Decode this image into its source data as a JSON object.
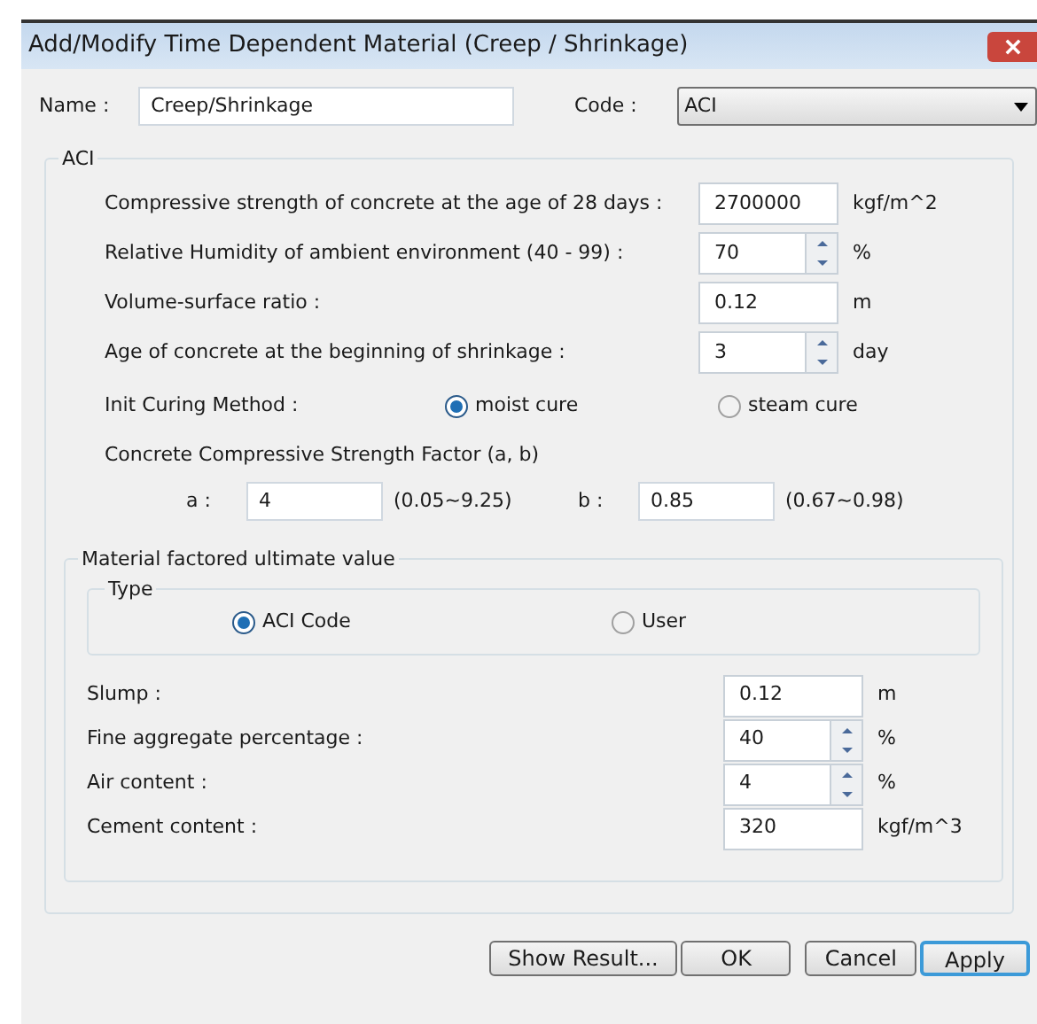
{
  "window": {
    "title": "Add/Modify Time Dependent Material (Creep / Shrinkage)"
  },
  "name": {
    "label": "Name :",
    "value": "Creep/Shrinkage"
  },
  "code": {
    "label": "Code :",
    "value": "ACI"
  },
  "aci_group": {
    "title": "ACI",
    "fields": [
      {
        "label": "Compressive strength of concrete at the age of 28 days :",
        "value": "2700000",
        "unit": "kgf/m^2",
        "kind": "text"
      },
      {
        "label": "Relative Humidity of ambient environment (40 - 99) :",
        "value": "70",
        "unit": "%",
        "kind": "spin"
      },
      {
        "label": "Volume-surface ratio :",
        "value": "0.12",
        "unit": "m",
        "kind": "text"
      },
      {
        "label": "Age of concrete at the beginning of shrinkage :",
        "value": "3",
        "unit": "day",
        "kind": "spin"
      }
    ],
    "curing": {
      "label": "Init Curing Method :",
      "options": [
        {
          "label": "moist cure",
          "selected": true
        },
        {
          "label": "steam cure",
          "selected": false
        }
      ]
    },
    "strength_factor": {
      "title": "Concrete Compressive Strength Factor (a, b)",
      "params": [
        {
          "label": "a :",
          "value": "4",
          "range": "(0.05~9.25)"
        },
        {
          "label": "b :",
          "value": "0.85",
          "range": "(0.67~0.98)"
        }
      ]
    }
  },
  "material_group": {
    "title": "Material factored ultimate value",
    "type_group": {
      "title": "Type",
      "options": [
        {
          "label": "ACI Code",
          "selected": true
        },
        {
          "label": "User",
          "selected": false
        }
      ]
    },
    "fields": [
      {
        "label": "Slump :",
        "value": "0.12",
        "unit": "m",
        "kind": "text"
      },
      {
        "label": "Fine aggregate percentage :",
        "value": "40",
        "unit": "%",
        "kind": "spin"
      },
      {
        "label": "Air content :",
        "value": "4",
        "unit": "%",
        "kind": "spin"
      },
      {
        "label": "Cement content :",
        "value": "320",
        "unit": "kgf/m^3",
        "kind": "text"
      }
    ]
  },
  "buttons": [
    {
      "label": "Show Result...",
      "default": false
    },
    {
      "label": "OK",
      "default": false
    },
    {
      "label": "Cancel",
      "default": false
    },
    {
      "label": "Apply",
      "default": true
    }
  ]
}
